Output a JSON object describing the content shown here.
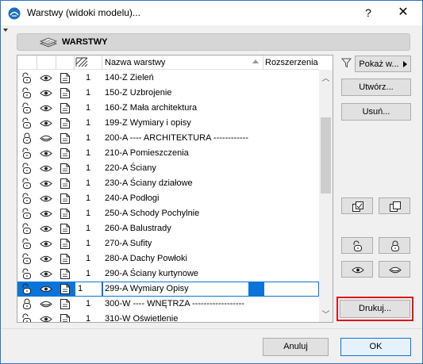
{
  "window": {
    "title": "Warstwy (widoki modelu)...",
    "help": "?",
    "close": "✕"
  },
  "header": {
    "title": "WARSTWY"
  },
  "list": {
    "columns": {
      "name": "Nazwa warstwy",
      "extensions": "Rozszerzenia"
    },
    "rows": [
      {
        "lock": "unlocked",
        "eye": "visible",
        "num": "1",
        "name": "140-Z Zieleń"
      },
      {
        "lock": "unlocked",
        "eye": "visible",
        "num": "1",
        "name": "150-Z Uzbrojenie"
      },
      {
        "lock": "unlocked",
        "eye": "visible",
        "num": "1",
        "name": "160-Z Mała architektura"
      },
      {
        "lock": "unlocked",
        "eye": "visible",
        "num": "1",
        "name": "199-Z Wymiary i opisy"
      },
      {
        "lock": "locked",
        "eye": "hidden",
        "num": "1",
        "name": "200-A ---- ARCHITEKTURA ------------"
      },
      {
        "lock": "unlocked",
        "eye": "visible",
        "num": "1",
        "name": "210-A Pomieszczenia"
      },
      {
        "lock": "unlocked",
        "eye": "visible",
        "num": "1",
        "name": "220-A Ściany"
      },
      {
        "lock": "unlocked",
        "eye": "visible",
        "num": "1",
        "name": "230-A Ściany działowe"
      },
      {
        "lock": "unlocked",
        "eye": "visible",
        "num": "1",
        "name": "240-A Podłogi"
      },
      {
        "lock": "unlocked",
        "eye": "visible",
        "num": "1",
        "name": "250-A Schody Pochylnie"
      },
      {
        "lock": "unlocked",
        "eye": "visible",
        "num": "1",
        "name": "260-A Balustrady"
      },
      {
        "lock": "unlocked",
        "eye": "visible",
        "num": "1",
        "name": "270-A Sufity"
      },
      {
        "lock": "unlocked",
        "eye": "visible",
        "num": "1",
        "name": "280-A Dachy Powłoki"
      },
      {
        "lock": "unlocked",
        "eye": "visible",
        "num": "1",
        "name": "290-A Ściany kurtynowe"
      },
      {
        "lock": "unlocked",
        "eye": "visible",
        "num": "1",
        "name": "299-A Wymiary Opisy",
        "selected": true
      },
      {
        "lock": "locked",
        "eye": "hidden",
        "num": "1",
        "name": "300-W ---- WNĘTRZA ------------------"
      },
      {
        "lock": "unlocked",
        "eye": "visible",
        "num": "1",
        "name": "310-W Oświetlenie"
      }
    ]
  },
  "side": {
    "show_label": "Pokaż w...",
    "create_label": "Utwórz...",
    "delete_label": "Usuń...",
    "print_label": "Drukuj..."
  },
  "footer": {
    "cancel_label": "Anuluj",
    "ok_label": "OK"
  },
  "colors": {
    "selection": "#0a74d9",
    "highlight": "#e0141b"
  }
}
